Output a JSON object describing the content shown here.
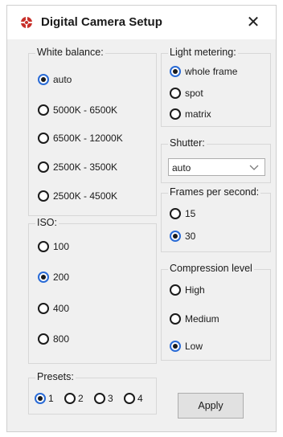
{
  "window": {
    "title": "Digital Camera Setup",
    "close_label": "✕"
  },
  "white_balance": {
    "label": "White balance:",
    "options": [
      "auto",
      "5000K - 6500K",
      "6500K - 12000K",
      "2500K - 3500K",
      "2500K - 4500K"
    ],
    "selected": "auto"
  },
  "light_metering": {
    "label": "Light metering:",
    "options": [
      "whole frame",
      "spot",
      "matrix"
    ],
    "selected": "whole frame"
  },
  "shutter": {
    "label": "Shutter:",
    "value": "auto"
  },
  "fps": {
    "label": "Frames per second:",
    "options": [
      "15",
      "30"
    ],
    "selected": "30"
  },
  "iso": {
    "label": "ISO:",
    "options": [
      "100",
      "200",
      "400",
      "800"
    ],
    "selected": "200"
  },
  "compression": {
    "label": "Compression level",
    "options": [
      "High",
      "Medium",
      "Low"
    ],
    "selected": "Low"
  },
  "presets": {
    "label": "Presets:",
    "options": [
      "1",
      "2",
      "3",
      "4"
    ],
    "selected": "1"
  },
  "apply_label": "Apply",
  "colors": {
    "window_bg": "#f0f0f0",
    "radio_accent": "#2a6bd6",
    "icon_red": "#c8302a"
  },
  "icons": {
    "app": "camera-app-icon",
    "close": "close-icon",
    "dropdown": "chevron-down-icon"
  }
}
